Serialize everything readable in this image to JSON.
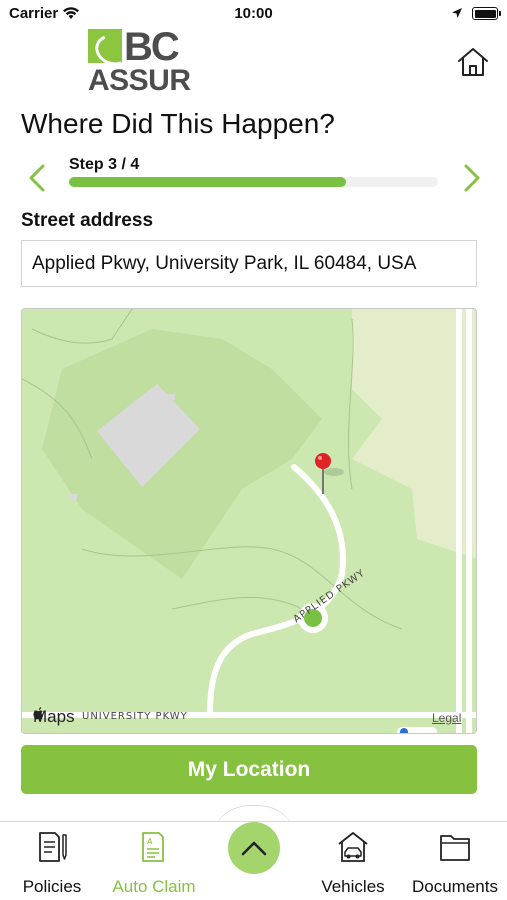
{
  "status_bar": {
    "carrier": "Carrier",
    "time": "10:00",
    "icons": [
      "wifi-icon",
      "location-arrow-icon",
      "battery-icon"
    ]
  },
  "header": {
    "logo_top": "BC",
    "logo_bottom": "ASSUR",
    "home_icon": "home-icon",
    "title": "Where Did This Happen?"
  },
  "stepper": {
    "label": "Step 3 / 4",
    "progress": 0.75,
    "prev_icon": "chevron-left-icon",
    "next_icon": "chevron-right-icon"
  },
  "address": {
    "label": "Street address",
    "value": "Applied Pkwy, University Park, IL 60484, USA"
  },
  "map": {
    "street_labels": [
      "APPLIED PKWY",
      "UNIVERSITY PKWY"
    ],
    "attribution": "Maps",
    "legal": "Legal",
    "pin_icon": "map-pin-icon",
    "user_dot_icon": "user-location-dot-icon"
  },
  "actions": {
    "my_location": "My Location"
  },
  "tab_bar": {
    "center_icon": "chevron-up-icon",
    "tabs": [
      {
        "label": "Policies",
        "icon": "policy-document-icon",
        "active": false
      },
      {
        "label": "Auto Claim",
        "icon": "claim-form-icon",
        "active": true
      },
      {
        "label": "Vehicles",
        "icon": "car-garage-icon",
        "active": false
      },
      {
        "label": "Documents",
        "icon": "folder-icon",
        "active": false
      }
    ]
  },
  "colors": {
    "brand_green": "#86c140",
    "logo_gray": "#4d4d4d",
    "progress_track": "#f0f0f0",
    "map_park": "#cde7b0",
    "map_land": "#e4edca"
  }
}
